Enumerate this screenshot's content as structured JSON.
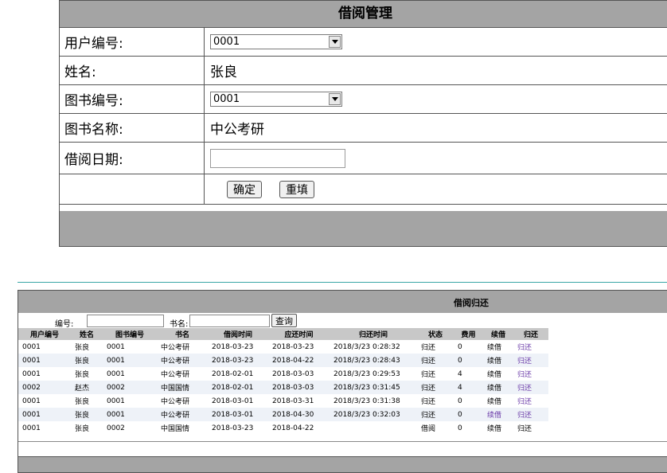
{
  "borrow_form": {
    "title": "借阅管理",
    "user_id_label": "用户编号:",
    "user_id_value": "0001",
    "name_label": "姓名:",
    "name_value": "张良",
    "book_id_label": "图书编号:",
    "book_id_value": "0001",
    "book_name_label": "图书名称:",
    "book_name_value": "中公考研",
    "borrow_date_label": "借阅日期:",
    "borrow_date_value": "",
    "confirm_label": "确定",
    "reset_label": "重填"
  },
  "loan_panel": {
    "title": "借阅归还",
    "search": {
      "id_label": "编号:",
      "id_value": "",
      "book_label": "书名:",
      "book_value": "",
      "query_label": "查询"
    },
    "columns": [
      "用户编号",
      "姓名",
      "图书编号",
      "书名",
      "借阅时间",
      "应还时间",
      "归还时间",
      "状态",
      "费用",
      "续借",
      "归还"
    ],
    "rows": [
      {
        "user_id": "0001",
        "name": "张良",
        "book_id": "0001",
        "book": "中公考研",
        "borrow": "2018-03-23",
        "due": "2018-03-23",
        "returned": "2018/3/23 0:28:32",
        "status": "归还",
        "fee": "0",
        "renew": "续借",
        "return_action": "归还",
        "renew_link": false,
        "return_link": true
      },
      {
        "user_id": "0001",
        "name": "张良",
        "book_id": "0001",
        "book": "中公考研",
        "borrow": "2018-03-23",
        "due": "2018-04-22",
        "returned": "2018/3/23 0:28:43",
        "status": "归还",
        "fee": "0",
        "renew": "续借",
        "return_action": "归还",
        "renew_link": false,
        "return_link": true
      },
      {
        "user_id": "0001",
        "name": "张良",
        "book_id": "0001",
        "book": "中公考研",
        "borrow": "2018-02-01",
        "due": "2018-03-03",
        "returned": "2018/3/23 0:29:53",
        "status": "归还",
        "fee": "4",
        "renew": "续借",
        "return_action": "归还",
        "renew_link": false,
        "return_link": true
      },
      {
        "user_id": "0002",
        "name": "赵杰",
        "book_id": "0002",
        "book": "中国国情",
        "borrow": "2018-02-01",
        "due": "2018-03-03",
        "returned": "2018/3/23 0:31:45",
        "status": "归还",
        "fee": "4",
        "renew": "续借",
        "return_action": "归还",
        "renew_link": false,
        "return_link": true
      },
      {
        "user_id": "0001",
        "name": "张良",
        "book_id": "0001",
        "book": "中公考研",
        "borrow": "2018-03-01",
        "due": "2018-03-31",
        "returned": "2018/3/23 0:31:38",
        "status": "归还",
        "fee": "0",
        "renew": "续借",
        "return_action": "归还",
        "renew_link": false,
        "return_link": true
      },
      {
        "user_id": "0001",
        "name": "张良",
        "book_id": "0001",
        "book": "中公考研",
        "borrow": "2018-03-01",
        "due": "2018-04-30",
        "returned": "2018/3/23 0:32:03",
        "status": "归还",
        "fee": "0",
        "renew": "续借",
        "return_action": "归还",
        "renew_link": true,
        "return_link": true
      },
      {
        "user_id": "0001",
        "name": "张良",
        "book_id": "0002",
        "book": "中国国情",
        "borrow": "2018-03-23",
        "due": "2018-04-22",
        "returned": "",
        "status": "借阅",
        "fee": "0",
        "renew": "续借",
        "return_action": "归还",
        "renew_link": false,
        "return_link": false
      }
    ]
  },
  "colors": {
    "header_gray": "#a4a4a4",
    "link_purple": "#6a3aa8",
    "divider_teal": "#3aa6a6"
  }
}
